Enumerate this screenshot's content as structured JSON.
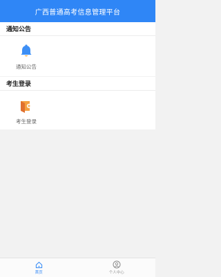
{
  "header": {
    "title": "广西普通高考信息管理平台"
  },
  "sections": [
    {
      "heading": "通知公告",
      "item": {
        "label": "通知公告",
        "icon": "bell-icon"
      }
    },
    {
      "heading": "考生登录",
      "item": {
        "label": "考生登录",
        "icon": "login-icon"
      }
    }
  ],
  "tabbar": {
    "home": {
      "label": "首页",
      "icon": "home-icon"
    },
    "profile": {
      "label": "个人中心",
      "icon": "user-icon"
    }
  },
  "colors": {
    "primary": "#2f86f6",
    "bell": "#3d8ff5",
    "login": "#f5a040"
  }
}
